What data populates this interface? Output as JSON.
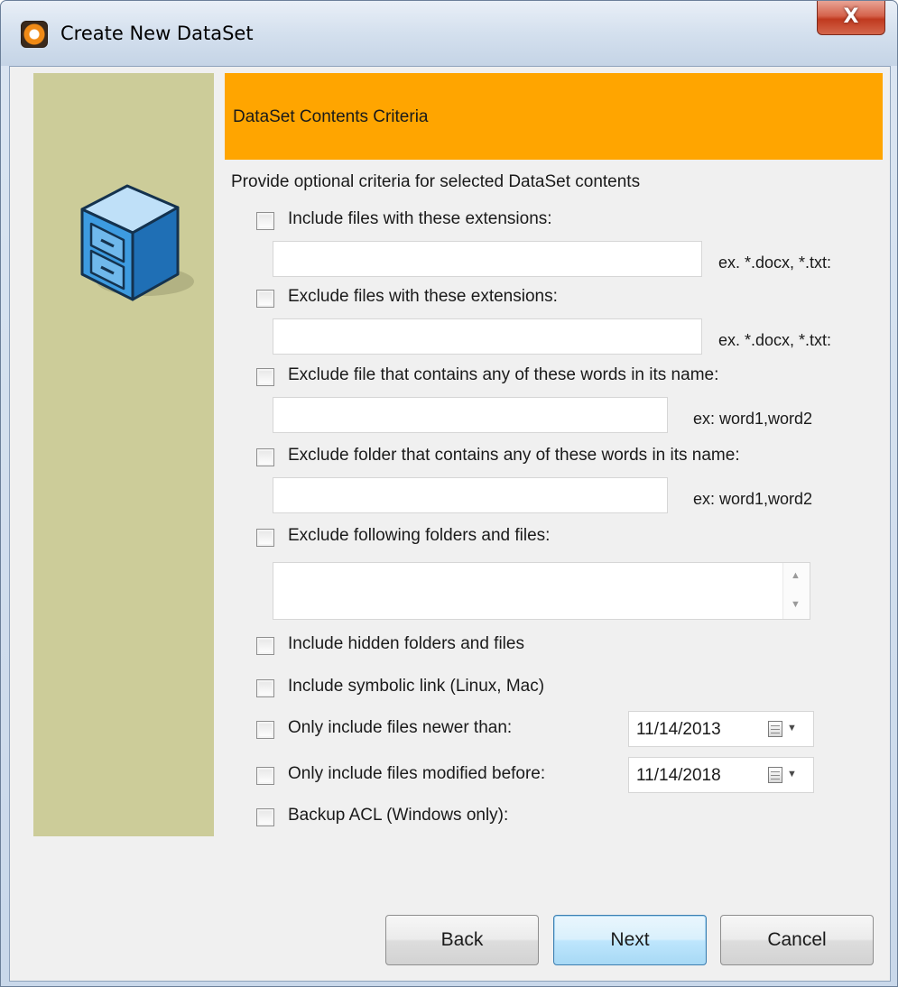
{
  "window": {
    "title": "Create New DataSet",
    "close_label": "X"
  },
  "header": {
    "title": "DataSet Contents Criteria"
  },
  "intro": "Provide optional criteria for selected DataSet contents",
  "criteria": {
    "include_ext": {
      "label": "Include files with these extensions:",
      "value": "",
      "hint": "ex. *.docx, *.txt:"
    },
    "exclude_ext": {
      "label": "Exclude files with these extensions:",
      "value": "",
      "hint": "ex. *.docx, *.txt:"
    },
    "exclude_file_words": {
      "label": "Exclude file that contains any of these words in its name:",
      "value": "",
      "hint": "ex: word1,word2"
    },
    "exclude_folder_words": {
      "label": "Exclude folder that contains any of these words in its name:",
      "value": "",
      "hint": "ex: word1,word2"
    },
    "exclude_paths": {
      "label": "Exclude following folders and files:",
      "value": ""
    },
    "include_hidden": {
      "label": "Include hidden folders and files"
    },
    "include_symlink": {
      "label": "Include symbolic link (Linux, Mac)"
    },
    "newer_than": {
      "label": "Only include files newer than:",
      "date": "11/14/2013"
    },
    "modified_before": {
      "label": "Only include files modified before:",
      "date": "11/14/2018"
    },
    "backup_acl": {
      "label": "Backup ACL (Windows only):"
    }
  },
  "buttons": {
    "back": "Back",
    "next": "Next",
    "cancel": "Cancel"
  },
  "colors": {
    "header_band": "#ffa500",
    "side_panel": "#cccc99",
    "cabinet": "#3d9be0"
  },
  "icons": {
    "app": "dataset-app-icon",
    "side": "file-cabinet-icon",
    "calendar": "calendar-icon"
  }
}
